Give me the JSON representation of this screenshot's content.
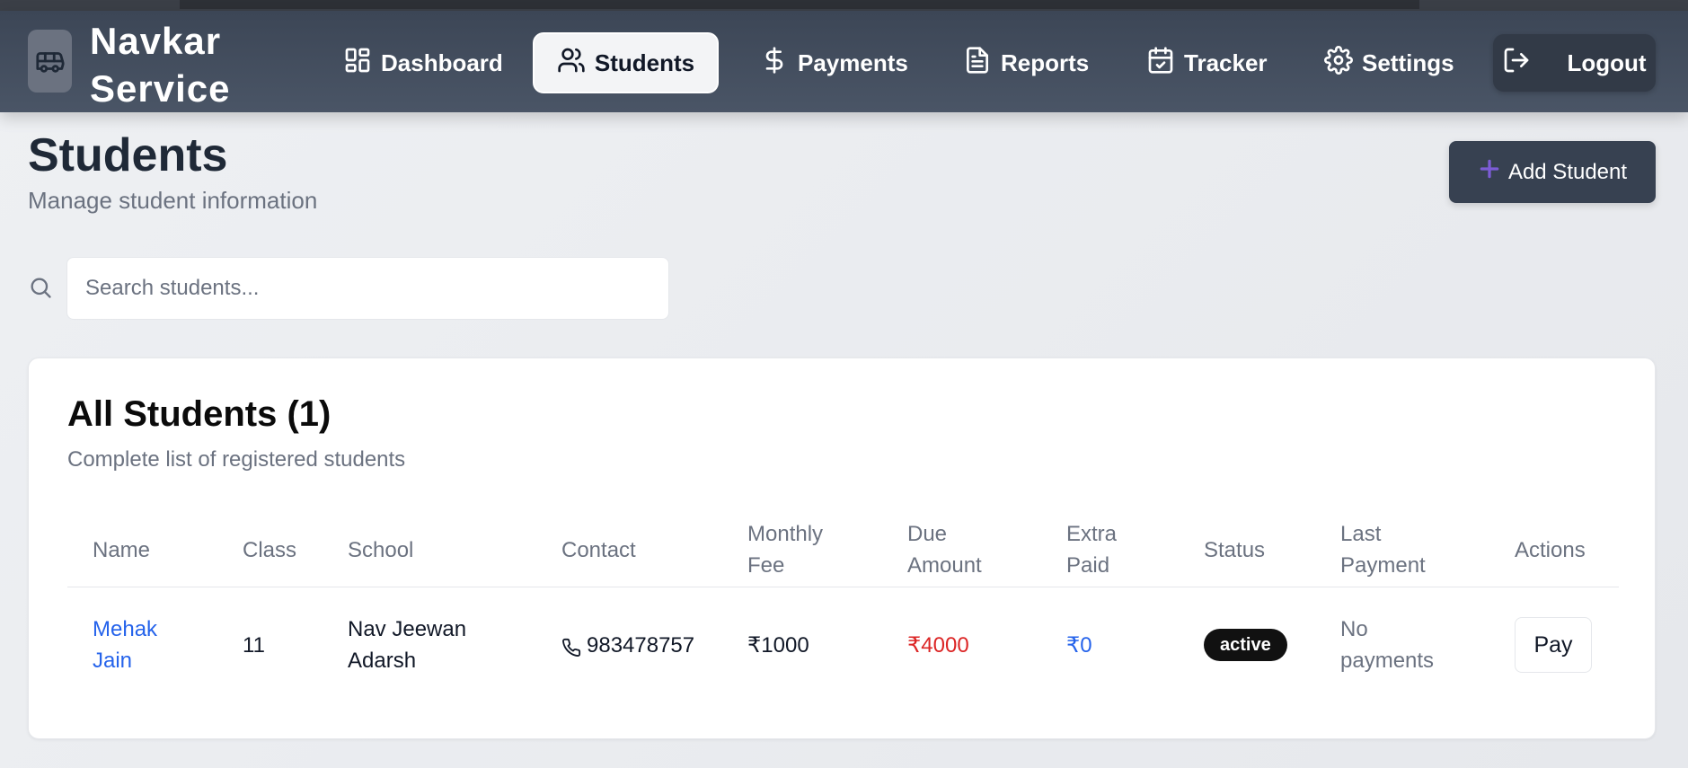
{
  "app": {
    "brand_line1": "Navkar",
    "brand_line2": "Service",
    "logo_icon": "bus-icon"
  },
  "nav": {
    "items": [
      {
        "label": "Dashboard",
        "icon": "dashboard-icon"
      },
      {
        "label": "Students",
        "icon": "users-icon",
        "active": true
      },
      {
        "label": "Payments",
        "icon": "dollar-icon"
      },
      {
        "label": "Reports",
        "icon": "file-text-icon"
      },
      {
        "label": "Tracker",
        "icon": "calendar-check-icon"
      },
      {
        "label": "Settings",
        "icon": "gear-icon"
      }
    ],
    "logout_label": "Logout"
  },
  "page": {
    "title": "Students",
    "subtitle": "Manage student information",
    "add_button_label": "Add Student"
  },
  "search": {
    "placeholder": "Search students...",
    "value": ""
  },
  "table_card": {
    "title": "All Students (1)",
    "subtitle": "Complete list of registered students",
    "columns": [
      {
        "line1": "Name",
        "line2": ""
      },
      {
        "line1": "Class",
        "line2": ""
      },
      {
        "line1": "School",
        "line2": ""
      },
      {
        "line1": "Contact",
        "line2": ""
      },
      {
        "line1": "Monthly",
        "line2": "Fee"
      },
      {
        "line1": "Due",
        "line2": "Amount"
      },
      {
        "line1": "Extra",
        "line2": "Paid"
      },
      {
        "line1": "Status",
        "line2": ""
      },
      {
        "line1": "Last",
        "line2": "Payment"
      },
      {
        "line1": "Actions",
        "line2": ""
      }
    ],
    "rows": [
      {
        "name_line1": "Mehak",
        "name_line2": "Jain",
        "class": "11",
        "school_line1": "Nav Jeewan",
        "school_line2": "Adarsh",
        "contact": "983478757",
        "monthly_fee": "₹1000",
        "due_amount": "₹4000",
        "extra_paid": "₹0",
        "status": "active",
        "last_payment_line1": "No",
        "last_payment_line2": "payments",
        "action_label": "Pay"
      }
    ]
  },
  "colors": {
    "navbar": "#3c4656",
    "due": "#dc2626",
    "link": "#2563eb",
    "accent_plus": "#7c5cd6"
  }
}
